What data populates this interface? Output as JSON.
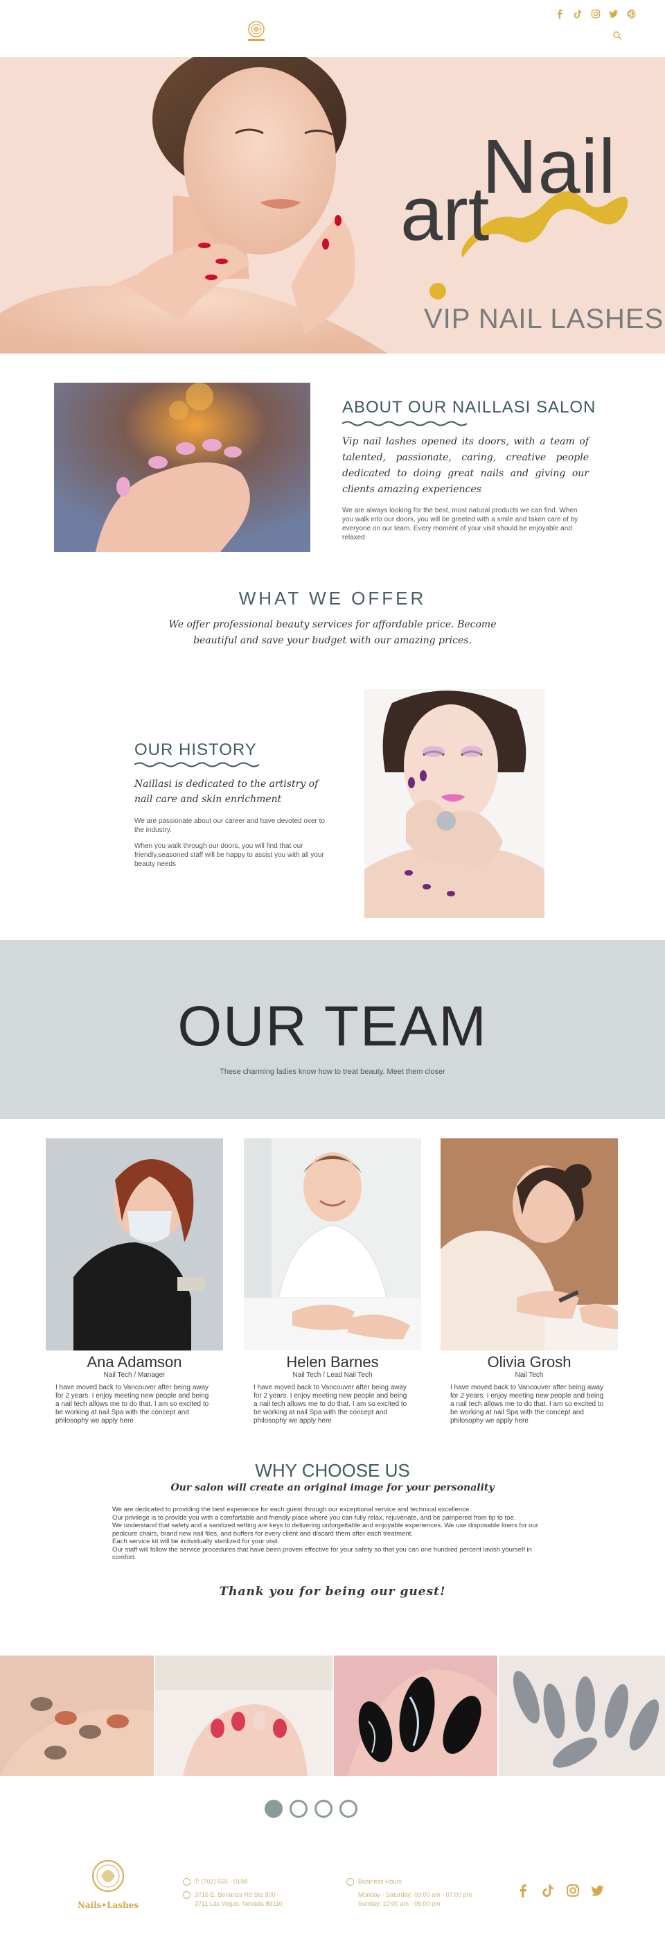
{
  "header": {
    "logo_alt": "Nails Lashes",
    "social": [
      {
        "icon": "facebook-icon",
        "glyph": "f"
      },
      {
        "icon": "tiktok-icon",
        "glyph": "♪"
      },
      {
        "icon": "instagram-icon",
        "glyph": "◎"
      },
      {
        "icon": "twitter-icon",
        "glyph": "🐦"
      },
      {
        "icon": "pinterest-icon",
        "glyph": "P"
      }
    ]
  },
  "hero": {
    "word1": "Nail",
    "word2": "art",
    "tagline": "VIP NAIL LASHES"
  },
  "about": {
    "title": "ABOUT OUR NAILLASI SALON",
    "script": "Vip nail lashes opened its doors, with a team of talented, passionate, caring, creative people dedicated to doing great nails and giving our clients amazing experiences",
    "body": "We are always looking for the best, most natural products we can find. When you walk into our doors, you will be greeted with a smile and taken care of by everyone on our team. Every moment of your visit should be enjoyable and relaxed"
  },
  "offer": {
    "title": "WHAT WE OFFER",
    "script": "We offer professional beauty services for affordable price. Become beautiful and save your budget with our amazing prices."
  },
  "history": {
    "title": "OUR HISTORY",
    "script": "Naillasi is dedicated to the artistry of nail care and skin enrichment",
    "body1": "We are passionate about our career and have devoted over to the industry.",
    "body2": "When you walk through our doors, you will find that our friendly,seasoned staff will be happy to assist you with all your beauty needs"
  },
  "team": {
    "title": "OUR TEAM",
    "subtitle": "These charming ladies know how to treat beauty. Meet them closer",
    "members": [
      {
        "name": "Ana Adamson",
        "role": "Nail Tech / Manager",
        "bio": "I have moved back to Vancouver after being away for 2 years. I enjoy meeting new people and being a nail tech allows me to do that. I am so excited to be working at nail Spa with the concept and philosophy we apply here"
      },
      {
        "name": "Helen Barnes",
        "role": "Nail Tech / Lead Nail Tech",
        "bio": "I have moved back to Vancouver after being away for 2 years. I enjoy meeting new people and being a nail tech allows me to do that. I am so excited to be working at nail Spa with the concept and philosophy we apply here"
      },
      {
        "name": "Olivia Grosh",
        "role": "Nail Tech",
        "bio": "I have moved back to Vancouver after being away for 2 years. I enjoy meeting new people and being a nail tech allows me to do that. I am so excited to be working at nail Spa with the concept and philosophy we apply here"
      }
    ]
  },
  "why": {
    "title": "WHY CHOOSE US",
    "script": "Our salon will create an original image for your personality",
    "paragraphs": [
      "We are dedicated to providing the best experience for each guest through our exceptional service and technical excellence.",
      "Our privilege is to provide you with a comfortable and friendly place where you can fully relax, rejuvenate, and be pampered from tip to toe.",
      "We understand that safety and a sanitized setting are keys to delivering unforgettable and enjoyable experiences. We use disposable liners for our pedicure chairs, brand new nail files, and buffers for every client and discard them after each treatment.",
      "Each service kit will be individually sterilized for your visit.",
      "Our staff will follow the service procedures that have been proven effective for your safety so that you can one hundred percent lavish yourself in comfort."
    ],
    "thanks": "Thank you for being our guest!"
  },
  "footer": {
    "logo_text": "Nails•Lashes",
    "phone": "T: (702) 555 - 0198",
    "address_line1": "3715 E. Bonanza Rd Ste 800",
    "address_line2": "3711 Las Vegas, Nevada 89110",
    "hours_title": "Business Hours",
    "hours_line1": "Monday - Saturday: 09:00 am - 07:00 pm",
    "hours_line2": "Sunday: 10:00 am - 05:00 pm",
    "social": [
      {
        "icon": "facebook-icon",
        "glyph": "f"
      },
      {
        "icon": "tiktok-icon",
        "glyph": "♪"
      },
      {
        "icon": "instagram-icon",
        "glyph": "◎"
      },
      {
        "icon": "twitter-icon",
        "glyph": "🐦"
      }
    ]
  },
  "colors": {
    "accent_gold": "#d4a94a",
    "title_teal": "#3f5a60",
    "hero_bg": "#f5ddd2",
    "team_band": "#d3d9da",
    "dot": "#8c9a9c"
  }
}
